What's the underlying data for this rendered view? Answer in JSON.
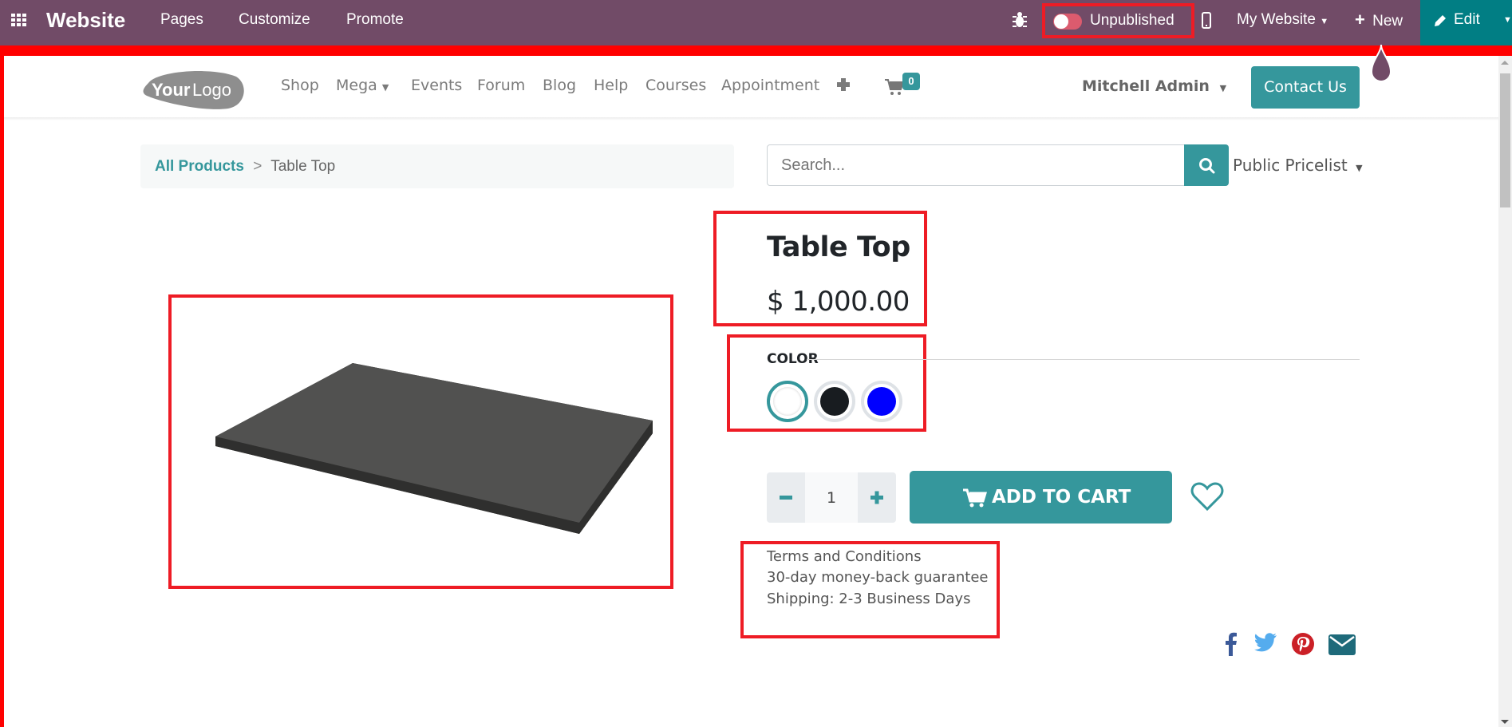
{
  "editor_bar": {
    "app_name": "Website",
    "menu": [
      "Pages",
      "Customize",
      "Promote"
    ],
    "publish_toggle_label": "Unpublished",
    "publish_state": false,
    "website_selector": "My Website",
    "new_label": "New",
    "edit_label": "Edit",
    "bg_color": "#714b67",
    "edit_bg_color": "#017e84"
  },
  "site_header": {
    "logo_text_bold": "Your",
    "logo_text_light": "Logo",
    "nav": [
      "Shop",
      "Mega",
      "Events",
      "Forum",
      "Blog",
      "Help",
      "Courses",
      "Appointment"
    ],
    "cart_count": "0",
    "user_name": "Mitchell Admin",
    "contact_label": "Contact Us"
  },
  "breadcrumb": {
    "parent": "All Products",
    "separator": ">",
    "current": "Table Top"
  },
  "search": {
    "placeholder": "Search...",
    "value": ""
  },
  "pricelist": "Public Pricelist",
  "product": {
    "name": "Table Top",
    "price": "$ 1,000.00",
    "attribute_label": "COLOR",
    "colors": [
      {
        "name": "White",
        "hex": "#ffffff",
        "selected": true
      },
      {
        "name": "Black",
        "hex": "#181c20",
        "selected": false
      },
      {
        "name": "Blue",
        "hex": "#0000ff",
        "selected": false
      }
    ],
    "quantity": "1",
    "add_to_cart_label": "ADD TO CART",
    "terms": [
      "Terms and Conditions",
      "30-day money-back guarantee",
      "Shipping: 2-3 Business Days"
    ]
  },
  "share_icons": [
    "facebook-icon",
    "twitter-icon",
    "pinterest-icon",
    "email-icon"
  ],
  "colors": {
    "primary": "#35979c",
    "annotation_red": "#ee1c25"
  }
}
